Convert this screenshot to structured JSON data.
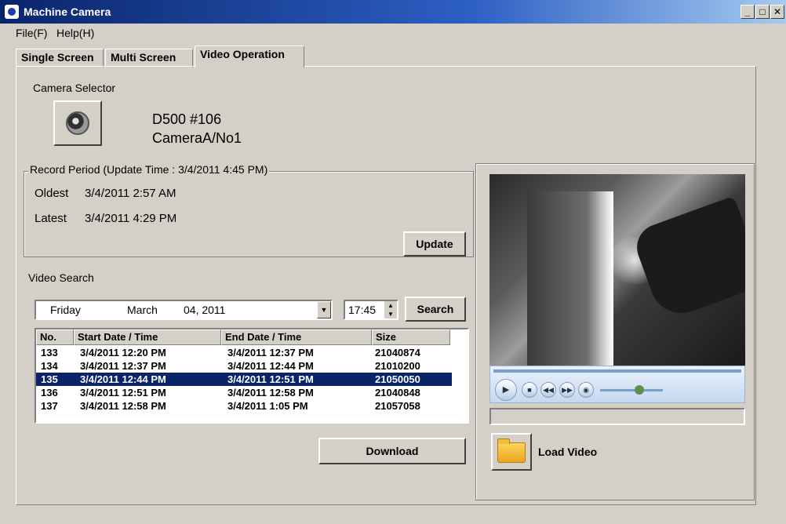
{
  "window": {
    "title": "Machine Camera",
    "min_glyph": "_",
    "max_glyph": "□",
    "close_glyph": "✕"
  },
  "menu": [
    {
      "label": "File(F)"
    },
    {
      "label": "Help(H)"
    }
  ],
  "tabs": [
    {
      "label": "Single Screen"
    },
    {
      "label": "Multi Screen"
    },
    {
      "label": "Video Operation"
    }
  ],
  "camera_selector": {
    "label": "Camera Selector",
    "camera_name": "D500 #106",
    "camera_sub": "CameraA/No1"
  },
  "record_period": {
    "label": "Record Period (Update Time : 3/4/2011 4:45 PM)",
    "oldest_label": "Oldest",
    "oldest_value": "3/4/2011 2:57 AM",
    "latest_label": "Latest",
    "latest_value": "3/4/2011 4:29 PM",
    "update_button": "Update"
  },
  "video_search": {
    "label": "Video Search",
    "date_day": "Friday",
    "date_month": "March",
    "date_rest": "04, 2011",
    "time": "17:45",
    "search_button": "Search",
    "columns": [
      "No.",
      "Start Date / Time",
      "End Date / Time",
      "Size"
    ],
    "rows": [
      {
        "no": "133",
        "start": "3/4/2011 12:20 PM",
        "end": "3/4/2011 12:37 PM",
        "size": "21040874",
        "selected": false
      },
      {
        "no": "134",
        "start": "3/4/2011 12:37 PM",
        "end": "3/4/2011 12:44 PM",
        "size": "21010200",
        "selected": false
      },
      {
        "no": "135",
        "start": "3/4/2011 12:44 PM",
        "end": "3/4/2011 12:51 PM",
        "size": "21050050",
        "selected": true
      },
      {
        "no": "136",
        "start": "3/4/2011 12:51 PM",
        "end": "3/4/2011 12:58 PM",
        "size": "21040848",
        "selected": false
      },
      {
        "no": "137",
        "start": "3/4/2011 12:58 PM",
        "end": "3/4/2011 1:05 PM",
        "size": "21057058",
        "selected": false
      }
    ],
    "download_button": "Download"
  },
  "player": {
    "load_video_label": "Load Video",
    "play_glyph": "▶",
    "stop_glyph": "■",
    "prev_glyph": "◀◀",
    "next_glyph": "▶▶",
    "mute_glyph": "◉"
  }
}
